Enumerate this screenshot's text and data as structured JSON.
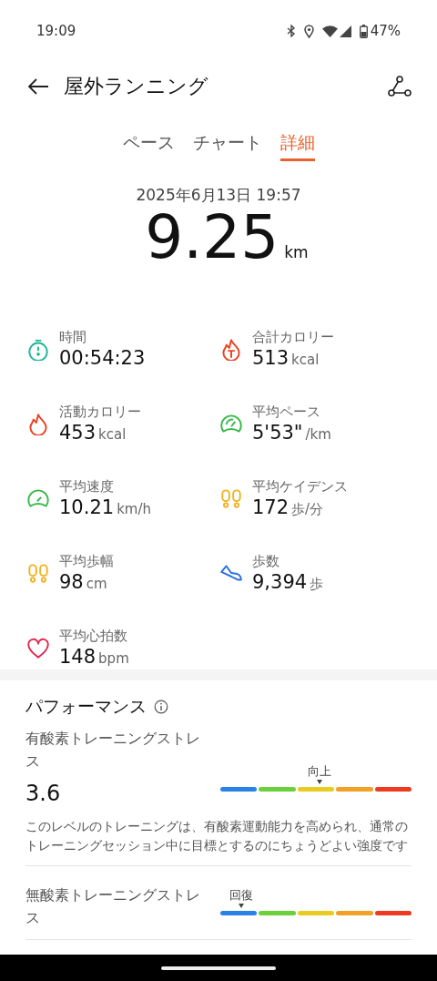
{
  "status_bar": {
    "time": "19:09",
    "battery": "47%"
  },
  "header": {
    "title": "屋外ランニング"
  },
  "tabs": [
    {
      "label": "ペース",
      "selected": false
    },
    {
      "label": "チャート",
      "selected": false
    },
    {
      "label": "詳細",
      "selected": true
    }
  ],
  "summary": {
    "date": "2025年6月13日 19:57",
    "distance": "9.25",
    "unit": "km"
  },
  "metrics": [
    {
      "kind": "timer",
      "label": "時間",
      "value": "00:54:23"
    },
    {
      "kind": "flame-total",
      "label": "合計カロリー",
      "value": "513",
      "unit": "kcal"
    },
    {
      "kind": "flame",
      "label": "活動カロリー",
      "value": "453",
      "unit": "kcal"
    },
    {
      "kind": "gauge-pace",
      "label": "平均ペース",
      "value": "5'53\"",
      "unit": "/km"
    },
    {
      "kind": "gauge-speed",
      "label": "平均速度",
      "value": "10.21",
      "unit": "km/h"
    },
    {
      "kind": "footprints-cadence",
      "label": "平均ケイデンス",
      "value": "172",
      "unit": "歩/分"
    },
    {
      "kind": "footprints-stride",
      "label": "平均歩幅",
      "value": "98",
      "unit": "cm"
    },
    {
      "kind": "shoe",
      "label": "歩数",
      "value": "9,394",
      "unit": "歩"
    },
    {
      "kind": "heart",
      "label": "平均心拍数",
      "value": "148",
      "unit": "bpm"
    }
  ],
  "performance": {
    "title": "パフォーマンス",
    "items": [
      {
        "label": "有酸素トレーニングストレス",
        "value": "3.6",
        "marker": "向上",
        "description": "このレベルのトレーニングは、有酸素運動能力を高められ、通常のトレーニングセッション中に目標とするのにちょうどよい強度です"
      },
      {
        "label": "無酸素トレーニングストレス",
        "marker": "回復"
      }
    ]
  }
}
